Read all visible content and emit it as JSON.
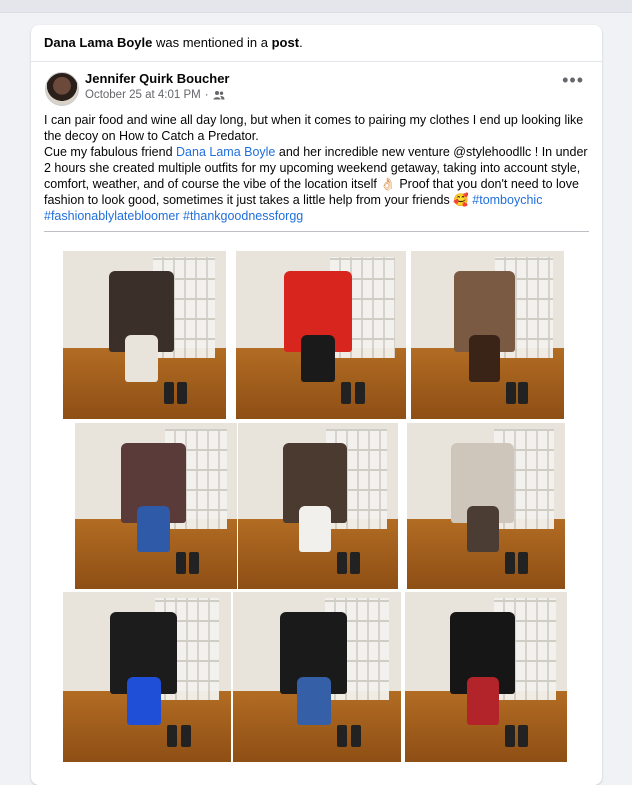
{
  "mention": {
    "name": "Dana Lama Boyle",
    "text1": " was mentioned in a ",
    "post": "post",
    "end": "."
  },
  "author": {
    "name": "Jennifer Quirk Boucher",
    "date": "October 25 at 4:01 PM",
    "sep": "·",
    "audience_icon": "friends-icon"
  },
  "more_label": "•••",
  "post_text": {
    "line1": "I can pair food and wine all day long, but when it comes to pairing my clothes I end up looking like the decoy on How to Catch a Predator.",
    "line2_a": "Cue my fabulous friend ",
    "line2_link": "Dana Lama Boyle",
    "line2_b": " and her incredible new venture @stylehoodllc ! In under 2 hours she created multiple outfits for my upcoming weekend getaway, taking into account style, comfort, weather, and of course the vibe of the location itself 👌🏻 Proof that you don't need to love fashion to look good, sometimes it just takes a little help from your friends 🥰 ",
    "hashtag1": "#tomboychic",
    "hashtag2": "#fashionablylatebloomer",
    "hashtag3": "#thankgoodnessforgg"
  },
  "photos": [
    {
      "label": "outfit-1",
      "garment": "#3b2f2a",
      "accent": "#e8e4dc"
    },
    {
      "label": "outfit-2",
      "garment": "#d8261e",
      "accent": "#1a1a1a"
    },
    {
      "label": "outfit-3",
      "garment": "#7a5a43",
      "accent": "#3a2418"
    },
    {
      "label": "outfit-4",
      "garment": "#5b3a3a",
      "accent": "#2f5aa8"
    },
    {
      "label": "outfit-5",
      "garment": "#4a3a30",
      "accent": "#f2f0ec"
    },
    {
      "label": "outfit-6",
      "garment": "#cfc6bb",
      "accent": "#4b3d33"
    },
    {
      "label": "outfit-7",
      "garment": "#1c1c1c",
      "accent": "#1f4fd6"
    },
    {
      "label": "outfit-8",
      "garment": "#1a1a1a",
      "accent": "#3560a8"
    },
    {
      "label": "outfit-9",
      "garment": "#161616",
      "accent": "#b3232a"
    }
  ],
  "colors": {
    "link": "#216fdb",
    "text": "#050505",
    "secondary": "#65676b",
    "background": "#f0f2f5"
  }
}
